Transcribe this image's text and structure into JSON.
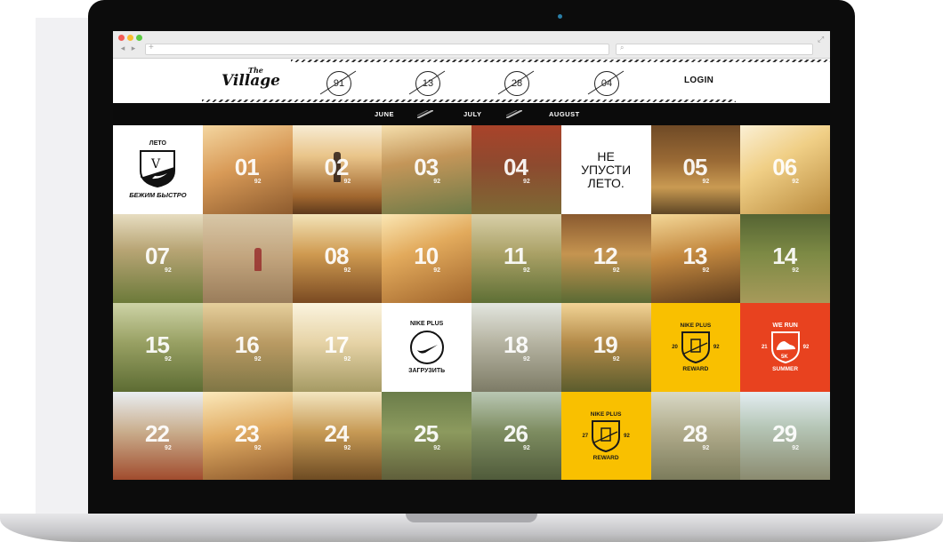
{
  "header": {
    "logo_the": "The",
    "logo": "Village",
    "numbers": [
      "91",
      "13",
      "28",
      "04"
    ],
    "login": "LOGIN"
  },
  "months": [
    "JUNE",
    "JULY",
    "AUGUST"
  ],
  "tiles": {
    "logo_tile": {
      "top": "ЛЕТО",
      "letter": "V",
      "bottom": "БЕЖИМ БЫСТРО"
    },
    "promo": {
      "l1": "НЕ",
      "l2": "УПУСТИ",
      "l3": "ЛЕТО."
    },
    "nike_upload": {
      "top": "NIKE PLUS",
      "bottom": "ЗАГРУЗИТЬ"
    },
    "reward_a": {
      "top": "NIKE PLUS",
      "left": "20",
      "right": "92",
      "bottom": "REWARD"
    },
    "reward_b": {
      "top": "NIKE PLUS",
      "left": "27",
      "right": "92",
      "bottom": "REWARD"
    },
    "we_run": {
      "top": "WE RUN",
      "left": "21",
      "right": "92",
      "mid": "5K",
      "bottom": "SUMMER"
    },
    "days": {
      "d01": "01",
      "d02": "02",
      "d03": "03",
      "d04": "04",
      "d05": "05",
      "d06": "06",
      "d07": "07",
      "d08": "08",
      "d10": "10",
      "d11": "11",
      "d12": "12",
      "d13": "13",
      "d14": "14",
      "d15": "15",
      "d16": "16",
      "d17": "17",
      "d18": "18",
      "d19": "19",
      "d22": "22",
      "d23": "23",
      "d24": "24",
      "d25": "25",
      "d26": "26",
      "d28": "28",
      "d29": "29",
      "sub": "92"
    }
  },
  "colors": {
    "yellow": "#f9c000",
    "red": "#e8421f",
    "dark": "#0b0b0b"
  }
}
